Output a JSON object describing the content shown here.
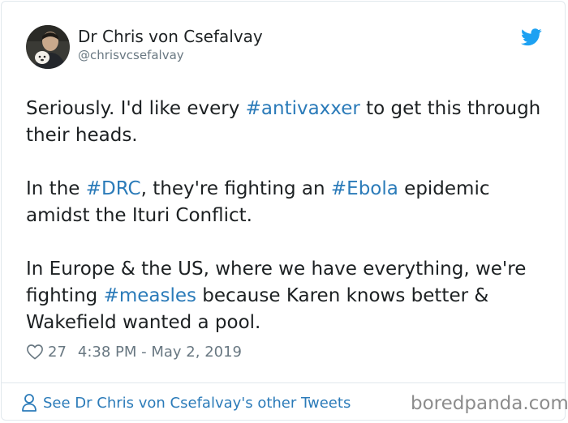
{
  "author": {
    "display_name": "Dr Chris von Csefalvay",
    "handle": "@chrisvcsefalvay"
  },
  "tweet": {
    "paragraphs": [
      [
        {
          "t": "Seriously. I'd like every "
        },
        {
          "t": "#antivaxxer",
          "tag": true
        },
        {
          "t": " to get this through their heads."
        }
      ],
      [
        {
          "t": "In the "
        },
        {
          "t": "#DRC",
          "tag": true
        },
        {
          "t": ", they're fighting an "
        },
        {
          "t": "#Ebola",
          "tag": true
        },
        {
          "t": " epidemic amidst the Ituri Conflict."
        }
      ],
      [
        {
          "t": "In Europe & the US, where we have everything, we're fighting "
        },
        {
          "t": "#measles",
          "tag": true
        },
        {
          "t": " because Karen knows better & Wakefield wanted a pool."
        }
      ]
    ]
  },
  "meta": {
    "like_count": "27",
    "timestamp": "4:38 PM - May 2, 2019"
  },
  "footer": {
    "link_text": "See Dr Chris von Csefalvay's other Tweets"
  },
  "watermark": "boredpanda.com",
  "colors": {
    "link": "#2b7bb9",
    "text": "#1c2022",
    "muted": "#697882",
    "twitter_blue": "#1da1f2",
    "border": "#e1e8ed"
  },
  "icons": {
    "brand": "twitter-bird-icon",
    "like": "heart-icon",
    "profile": "person-icon"
  }
}
